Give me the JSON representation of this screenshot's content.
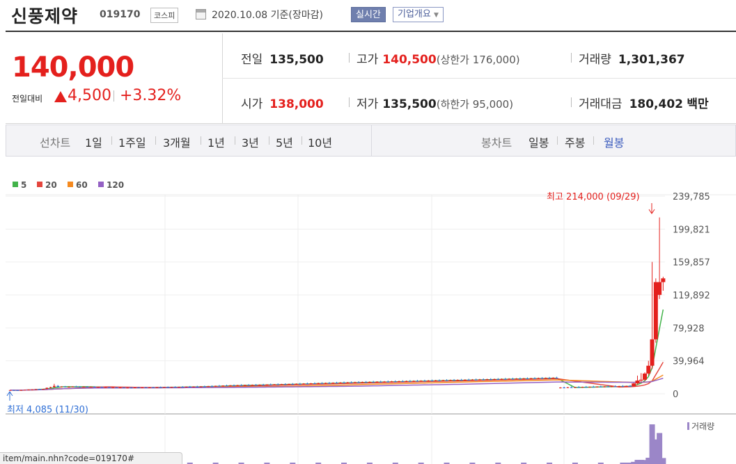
{
  "header": {
    "company": "신풍제약",
    "code": "019170",
    "market": "코스피",
    "date": "2020.10.08",
    "basis": "기준(장마감)",
    "realtime": "실시간",
    "corp_overview": "기업개요",
    "corp_caret": "▼"
  },
  "quote": {
    "price": "140,000",
    "change_label": "전일대비",
    "change_amount": "4,500",
    "change_rate": "+3.32%",
    "prev_label": "전일",
    "prev": "135,500",
    "high_label": "고가",
    "high": "140,500",
    "upper_limit": "(상한가 176,000)",
    "volume_label": "거래량",
    "volume": "1,301,367",
    "open_label": "시가",
    "open": "138,000",
    "low_label": "저가",
    "low": "135,500",
    "lower_limit": "(하한가 95,000)",
    "amount_label": "거래대금",
    "amount": "180,402",
    "amount_unit": "백만"
  },
  "periods": {
    "line_chart_label": "선차트",
    "items": [
      "1일",
      "1주일",
      "3개월",
      "1년",
      "3년",
      "5년",
      "10년"
    ],
    "candle_label": "봉차트",
    "candle_items": [
      "일봉",
      "주봉",
      "월봉"
    ],
    "candle_selected": "월봉"
  },
  "legend": [
    {
      "label": "5",
      "color": "#42b34a"
    },
    {
      "label": "20",
      "color": "#e4453d"
    },
    {
      "label": "60",
      "color": "#f58a1f"
    },
    {
      "label": "120",
      "color": "#9461c4"
    }
  ],
  "annotations": {
    "high": "최고 214,000 (09/29)",
    "low": "최저 4,085 (11/30)",
    "volume_legend": "거래량"
  },
  "colors": {
    "up": "#e4201d",
    "down": "#2f6fd6",
    "accent": "#3b5bbd"
  },
  "statusbar_url": "item/main.nhn?code=019170#",
  "chart_data": {
    "type": "candlestick",
    "period": "monthly",
    "y_ticks": [
      "239,785",
      "199,821",
      "159,857",
      "119,892",
      "79,928",
      "39,964",
      "0"
    ],
    "ylim": [
      0,
      239785
    ],
    "candles": [
      [
        4300,
        4600,
        4085,
        4400
      ],
      [
        4400,
        4700,
        4200,
        4300
      ],
      [
        4300,
        4500,
        4100,
        4200
      ],
      [
        4200,
        4600,
        4150,
        4500
      ],
      [
        4500,
        4900,
        4300,
        4800
      ],
      [
        4800,
        5200,
        4600,
        5000
      ],
      [
        5000,
        5400,
        4800,
        5300
      ],
      [
        5300,
        5800,
        5100,
        5600
      ],
      [
        5600,
        6000,
        5300,
        5500
      ],
      [
        5500,
        5900,
        5200,
        5800
      ],
      [
        5800,
        7500,
        5600,
        7200
      ],
      [
        7200,
        8500,
        6800,
        8000
      ],
      [
        8000,
        12000,
        7600,
        9500
      ],
      [
        9500,
        10500,
        7800,
        8200
      ],
      [
        8200,
        9000,
        7500,
        8700
      ],
      [
        8700,
        9400,
        8000,
        8100
      ],
      [
        8100,
        8800,
        7600,
        8400
      ],
      [
        8400,
        9000,
        7900,
        8900
      ],
      [
        8900,
        9600,
        8400,
        8600
      ],
      [
        8600,
        9200,
        8100,
        8300
      ],
      [
        8300,
        8900,
        7800,
        8600
      ],
      [
        8600,
        9100,
        8000,
        8200
      ],
      [
        8200,
        8800,
        7700,
        8500
      ],
      [
        8500,
        9000,
        7900,
        7900
      ],
      [
        7900,
        8500,
        7400,
        8200
      ],
      [
        8200,
        8700,
        7600,
        7700
      ],
      [
        7700,
        8300,
        7200,
        8000
      ],
      [
        8000,
        8500,
        7400,
        7500
      ],
      [
        7500,
        8100,
        7000,
        7800
      ],
      [
        7800,
        8300,
        7200,
        7300
      ],
      [
        7300,
        7900,
        6800,
        7600
      ],
      [
        7600,
        8100,
        7000,
        7100
      ],
      [
        7100,
        7700,
        6600,
        7400
      ],
      [
        7400,
        8000,
        6900,
        7200
      ],
      [
        7200,
        7800,
        6700,
        7600
      ],
      [
        7600,
        8200,
        7100,
        7300
      ],
      [
        7300,
        7900,
        6800,
        7700
      ],
      [
        7700,
        8300,
        7200,
        7400
      ],
      [
        7400,
        8000,
        6900,
        7800
      ],
      [
        7800,
        8400,
        7300,
        7500
      ],
      [
        7500,
        8200,
        7000,
        8000
      ],
      [
        8000,
        8700,
        7500,
        7600
      ],
      [
        7600,
        8300,
        7100,
        8100
      ],
      [
        8100,
        8800,
        7600,
        7700
      ],
      [
        7700,
        8400,
        7200,
        8200
      ],
      [
        8200,
        9000,
        7700,
        7800
      ],
      [
        7800,
        8500,
        7300,
        8300
      ],
      [
        8300,
        9200,
        7800,
        8000
      ],
      [
        8000,
        8800,
        7500,
        8600
      ],
      [
        8600,
        9400,
        8100,
        8200
      ],
      [
        8200,
        9000,
        7700,
        8700
      ],
      [
        8700,
        9600,
        8200,
        8400
      ],
      [
        8400,
        9200,
        7900,
        8900
      ],
      [
        8900,
        9800,
        8400,
        8600
      ],
      [
        8600,
        9500,
        8100,
        9200
      ],
      [
        9200,
        10200,
        8700,
        8800
      ],
      [
        8800,
        9800,
        8300,
        9600
      ],
      [
        9600,
        10600,
        9100,
        9200
      ],
      [
        9200,
        10200,
        8700,
        9900
      ],
      [
        9900,
        11000,
        9400,
        9500
      ],
      [
        9500,
        10500,
        9000,
        10200
      ],
      [
        10200,
        11200,
        9700,
        9800
      ],
      [
        9800,
        10800,
        9300,
        10400
      ],
      [
        10400,
        11500,
        9900,
        10000
      ],
      [
        10000,
        11000,
        9500,
        10600
      ],
      [
        10600,
        11600,
        10100,
        10200
      ],
      [
        10200,
        11200,
        9700,
        10700
      ],
      [
        10700,
        11800,
        10200,
        10300
      ],
      [
        10300,
        11300,
        9800,
        10900
      ],
      [
        10900,
        12000,
        10400,
        10500
      ],
      [
        10500,
        11500,
        10000,
        11200
      ],
      [
        11200,
        12300,
        10700,
        10800
      ],
      [
        10800,
        11800,
        10300,
        11400
      ],
      [
        11400,
        12500,
        10900,
        11000
      ],
      [
        11000,
        12000,
        10500,
        11600
      ],
      [
        11600,
        12700,
        11100,
        11200
      ],
      [
        11200,
        12200,
        10700,
        11800
      ],
      [
        11800,
        12900,
        11300,
        11400
      ],
      [
        11400,
        12500,
        10900,
        12000
      ],
      [
        12000,
        13200,
        11500,
        11600
      ],
      [
        11600,
        12800,
        11100,
        12300
      ],
      [
        12300,
        13500,
        11800,
        11900
      ],
      [
        11900,
        13100,
        11400,
        12600
      ],
      [
        12600,
        13800,
        12100,
        12200
      ],
      [
        12200,
        13400,
        11700,
        12800
      ],
      [
        12800,
        14000,
        12300,
        12400
      ],
      [
        12400,
        13600,
        11900,
        13000
      ],
      [
        13000,
        14200,
        12500,
        12600
      ],
      [
        12600,
        13800,
        12100,
        13300
      ],
      [
        13300,
        14500,
        12800,
        12900
      ],
      [
        12900,
        14100,
        12400,
        13500
      ],
      [
        13500,
        14800,
        13000,
        13100
      ],
      [
        13100,
        14300,
        12600,
        13700
      ],
      [
        13700,
        15000,
        13200,
        13300
      ],
      [
        13300,
        14600,
        12800,
        13900
      ],
      [
        13900,
        15200,
        13400,
        13500
      ],
      [
        13500,
        14800,
        13000,
        14100
      ],
      [
        14100,
        15400,
        13600,
        13700
      ],
      [
        13700,
        15000,
        13200,
        14300
      ],
      [
        14300,
        15600,
        13800,
        13900
      ],
      [
        13900,
        15200,
        13400,
        14500
      ],
      [
        14500,
        15800,
        14000,
        14100
      ],
      [
        14100,
        15400,
        13600,
        14700
      ],
      [
        14700,
        16000,
        14200,
        14300
      ],
      [
        14300,
        15600,
        13800,
        14900
      ],
      [
        14900,
        16200,
        14400,
        14500
      ],
      [
        14500,
        15800,
        14000,
        15100
      ],
      [
        15100,
        16400,
        14600,
        14700
      ],
      [
        14700,
        16000,
        14200,
        15300
      ],
      [
        15300,
        16600,
        14800,
        14900
      ],
      [
        14900,
        16200,
        14400,
        15500
      ],
      [
        15500,
        16800,
        15000,
        15100
      ],
      [
        15100,
        16400,
        14600,
        15700
      ],
      [
        15700,
        17000,
        15200,
        15300
      ],
      [
        15300,
        16600,
        14800,
        15900
      ],
      [
        15900,
        17200,
        15400,
        15500
      ],
      [
        15500,
        16800,
        15000,
        16100
      ],
      [
        16100,
        17400,
        15600,
        15700
      ],
      [
        15700,
        17000,
        15200,
        16300
      ],
      [
        16300,
        17600,
        15800,
        15900
      ],
      [
        15900,
        17200,
        15400,
        16500
      ],
      [
        16500,
        17800,
        16000,
        16100
      ],
      [
        16100,
        17400,
        15600,
        16700
      ],
      [
        16700,
        18000,
        16200,
        16300
      ],
      [
        16300,
        17600,
        15800,
        16900
      ],
      [
        16900,
        18200,
        16400,
        16500
      ],
      [
        16500,
        17800,
        16000,
        17100
      ],
      [
        17100,
        18400,
        16600,
        16700
      ],
      [
        16700,
        18000,
        16200,
        17300
      ],
      [
        17300,
        18600,
        16800,
        16900
      ],
      [
        16900,
        18200,
        16400,
        17500
      ],
      [
        17500,
        18800,
        17000,
        17100
      ],
      [
        17100,
        18400,
        16600,
        17700
      ],
      [
        17700,
        19000,
        17200,
        17300
      ],
      [
        17300,
        18600,
        16800,
        17900
      ],
      [
        17900,
        19200,
        17400,
        17500
      ],
      [
        17500,
        18800,
        17000,
        18100
      ],
      [
        18100,
        19400,
        17600,
        17700
      ],
      [
        17700,
        19000,
        17200,
        18300
      ],
      [
        18300,
        19600,
        17800,
        17900
      ],
      [
        17900,
        19200,
        17400,
        18500
      ],
      [
        18500,
        19800,
        18000,
        18100
      ],
      [
        18100,
        19400,
        17600,
        18700
      ],
      [
        18700,
        20000,
        18200,
        18300
      ],
      [
        18300,
        19600,
        17800,
        18900
      ],
      [
        18900,
        20200,
        18400,
        18500
      ],
      [
        18500,
        19800,
        18000,
        19100
      ],
      [
        19100,
        20400,
        18600,
        18700
      ],
      [
        18700,
        20000,
        18200,
        19300
      ],
      [
        19300,
        20600,
        18800,
        18900
      ],
      [
        7000,
        8000,
        6500,
        7500
      ],
      [
        7500,
        8500,
        7000,
        7200
      ],
      [
        7200,
        8200,
        6800,
        7800
      ],
      [
        7800,
        9000,
        7300,
        7400
      ],
      [
        7400,
        8400,
        6900,
        8000
      ],
      [
        8000,
        9200,
        7500,
        7600
      ],
      [
        7600,
        8600,
        7100,
        8200
      ],
      [
        8200,
        9400,
        7700,
        7800
      ],
      [
        7800,
        8800,
        7300,
        8400
      ],
      [
        8400,
        9600,
        7900,
        8000
      ],
      [
        8000,
        9000,
        7500,
        8600
      ],
      [
        8600,
        9800,
        8100,
        8200
      ],
      [
        8200,
        9200,
        7700,
        8800
      ],
      [
        8800,
        10000,
        8300,
        8400
      ],
      [
        8400,
        9400,
        7900,
        9000
      ],
      [
        9000,
        10200,
        8500,
        8600
      ],
      [
        8600,
        9600,
        8100,
        9200
      ],
      [
        9200,
        10400,
        8700,
        8800
      ],
      [
        8800,
        9800,
        8300,
        9400
      ],
      [
        9400,
        10600,
        8900,
        9000
      ],
      [
        9000,
        13000,
        8500,
        12500
      ],
      [
        12500,
        22000,
        11000,
        16000
      ],
      [
        16000,
        25000,
        14000,
        17000
      ],
      [
        17000,
        26000,
        15500,
        24500
      ],
      [
        24500,
        40000,
        22000,
        34000
      ],
      [
        34000,
        160000,
        30000,
        66000
      ],
      [
        66000,
        140000,
        62000,
        135500
      ],
      [
        120000,
        214000,
        115000,
        135500
      ],
      [
        135500,
        142000,
        125000,
        140000
      ]
    ],
    "volume_legend": "거래량"
  }
}
